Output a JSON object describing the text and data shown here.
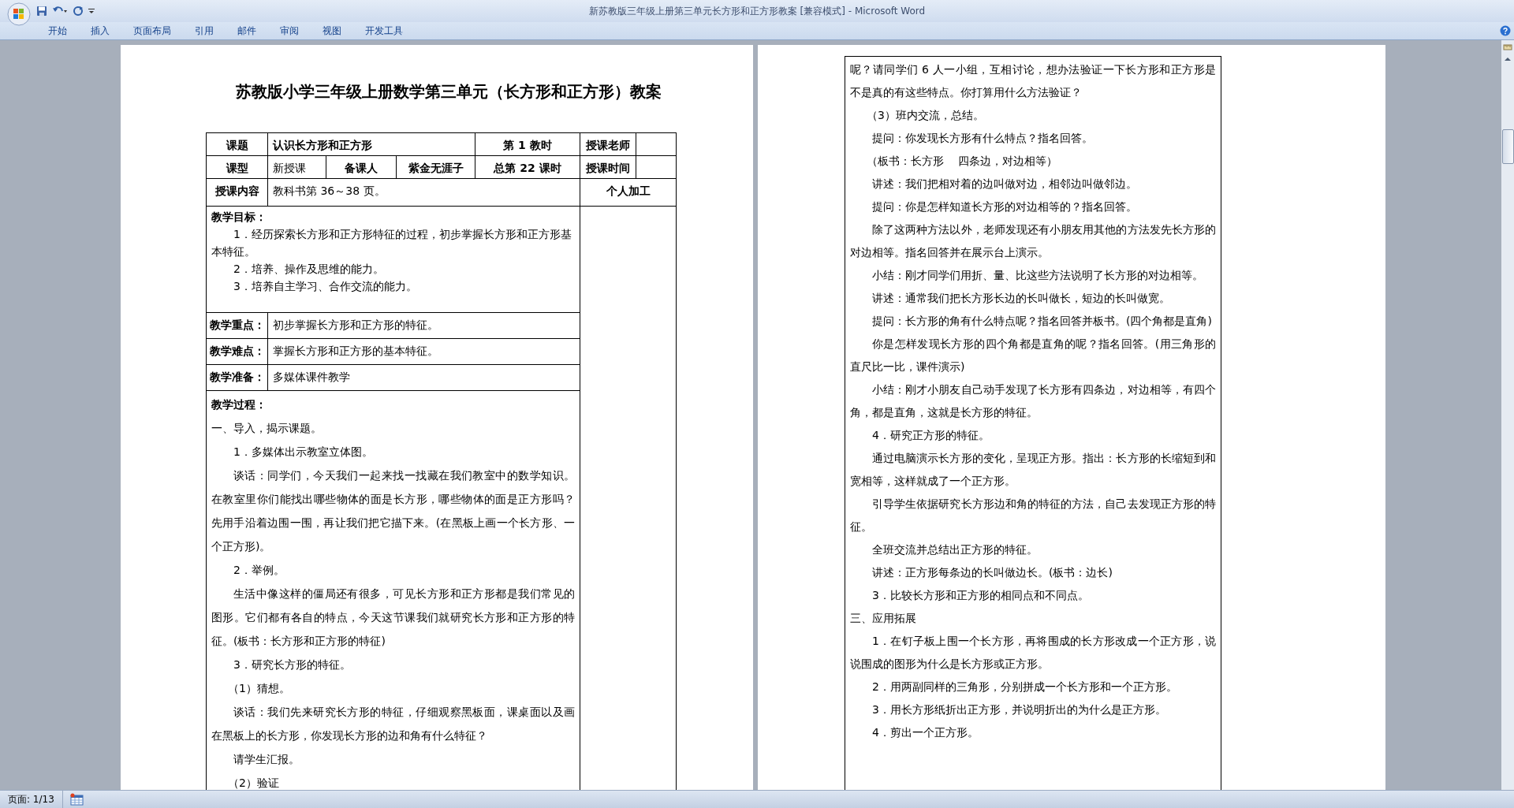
{
  "window": {
    "title": "新苏教版三年级上册第三单元长方形和正方形教案 [兼容模式] - Microsoft Word"
  },
  "ribbon_tabs": [
    {
      "label": "开始"
    },
    {
      "label": "插入"
    },
    {
      "label": "页面布局"
    },
    {
      "label": "引用"
    },
    {
      "label": "邮件"
    },
    {
      "label": "审阅"
    },
    {
      "label": "视图"
    },
    {
      "label": "开发工具"
    }
  ],
  "left_page": {
    "title": "苏教版小学三年级上册数学第三单元（长方形和正方形）教案",
    "lesson_table": {
      "topic_label": "课题",
      "topic": "认识长方形和正方形",
      "period": "第 1 教时",
      "teacher_label": "授课老师",
      "type_label": "课型",
      "type": "新授课",
      "preparer_label": "备课人",
      "preparer": "紫金无涯子",
      "total_period": "总第 22 课时",
      "time_label": "授课时间",
      "content_label": "授课内容",
      "content": "教科书第 36～38 页。",
      "personal_label": "个人加工",
      "goals_label": "教学目标：",
      "goals": [
        "1．经历探索长方形和正方形特征的过程，初步掌握长方形和正方形基本特征。",
        "2．培养、操作及思维的能力。",
        "3．培养自主学习、合作交流的能力。"
      ],
      "key_point_label": "教学重点：",
      "key_point": "初步掌握长方形和正方形的特征。",
      "difficulty_label": "教学难点：",
      "difficulty": "掌握长方形和正方形的基本特征。",
      "preparation_label": "教学准备：",
      "preparation": "多媒体课件教学",
      "process_label": "教学过程：",
      "process": [
        {
          "kind": "flush",
          "text": "一、导入，揭示课题。"
        },
        {
          "kind": "indented",
          "text": "1．多媒体出示教室立体图。"
        },
        {
          "kind": "indented",
          "text": "谈话：同学们，今天我们一起来找一找藏在我们教室中的数学知识。在教室里你们能找出哪些物体的面是长方形，哪些物体的面是正方形吗？先用手沿着边围一围，再让我们把它描下来。(在黑板上画一个长方形、一个正方形)。"
        },
        {
          "kind": "indented",
          "text": "2．举例。"
        },
        {
          "kind": "indented",
          "text": "生活中像这样的僵局还有很多，可见长方形和正方形都是我们常见的图形。它们都有各自的特点，今天这节课我们就研究长方形和正方形的特征。(板书：长方形和正方形的特征)"
        },
        {
          "kind": "indented",
          "text": "3．研究长方形的特征。"
        },
        {
          "kind": "sub",
          "text": "（1）猜想。"
        },
        {
          "kind": "indented",
          "text": "谈话：我们先来研究长方形的特征，仔细观察黑板面，课桌面以及画在黑板上的长方形，你发现长方形的边和角有什么特征？"
        },
        {
          "kind": "indented",
          "text": "请学生汇报。"
        },
        {
          "kind": "sub",
          "text": "（2）验证"
        }
      ]
    }
  },
  "right_page": {
    "paragraphs": [
      {
        "kind": "flush",
        "text": "呢？请同学们 6 人一小组，互相讨论，想办法验证一下长方形和正方形是不是真的有这些特点。你打算用什么方法验证？"
      },
      {
        "kind": "sub",
        "text": "（3）班内交流，总结。"
      },
      {
        "kind": "indented",
        "text": "提问：你发现长方形有什么特点？指名回答。"
      },
      {
        "kind": "sub",
        "text": "（板书：长方形　 四条边，对边相等）"
      },
      {
        "kind": "indented",
        "text": "讲述：我们把相对着的边叫做对边，相邻边叫做邻边。"
      },
      {
        "kind": "indented",
        "text": "提问：你是怎样知道长方形的对边相等的？指名回答。"
      },
      {
        "kind": "indented",
        "text": "除了这两种方法以外，老师发现还有小朋友用其他的方法发先长方形的对边相等。指名回答并在展示台上演示。"
      },
      {
        "kind": "indented",
        "text": "小结：刚才同学们用折、量、比这些方法说明了长方形的对边相等。"
      },
      {
        "kind": "indented",
        "text": "讲述：通常我们把长方形长边的长叫做长，短边的长叫做宽。"
      },
      {
        "kind": "indented",
        "text": "提问：长方形的角有什么特点呢？指名回答并板书。(四个角都是直角)"
      },
      {
        "kind": "indented",
        "text": "你是怎样发现长方形的四个角都是直角的呢？指名回答。(用三角形的直尺比一比，课件演示)"
      },
      {
        "kind": "indented",
        "text": "小结：刚才小朋友自己动手发现了长方形有四条边，对边相等，有四个角，都是直角，这就是长方形的特征。"
      },
      {
        "kind": "indented",
        "text": "4．研究正方形的特征。"
      },
      {
        "kind": "indented",
        "text": "通过电脑演示长方形的变化，呈现正方形。指出：长方形的长缩短到和宽相等，这样就成了一个正方形。"
      },
      {
        "kind": "indented",
        "text": "引导学生依据研究长方形边和角的特征的方法，自己去发现正方形的特征。"
      },
      {
        "kind": "indented",
        "text": "全班交流并总结出正方形的特征。"
      },
      {
        "kind": "indented",
        "text": "讲述：正方形每条边的长叫做边长。(板书：边长)"
      },
      {
        "kind": "indented",
        "text": "3．比较长方形和正方形的相同点和不同点。"
      },
      {
        "kind": "flush",
        "text": "三、应用拓展"
      },
      {
        "kind": "indented",
        "text": "1．在钉子板上围一个长方形，再将围成的长方形改成一个正方形，说说围成的图形为什么是长方形或正方形。"
      },
      {
        "kind": "indented",
        "text": "2．用两副同样的三角形，分别拼成一个长方形和一个正方形。"
      },
      {
        "kind": "indented",
        "text": "3．用长方形纸折出正方形，并说明折出的为什么是正方形。"
      },
      {
        "kind": "indented",
        "text": "4．剪出一个正方形。"
      }
    ]
  },
  "status_bar": {
    "page": "页面: 1/13"
  }
}
